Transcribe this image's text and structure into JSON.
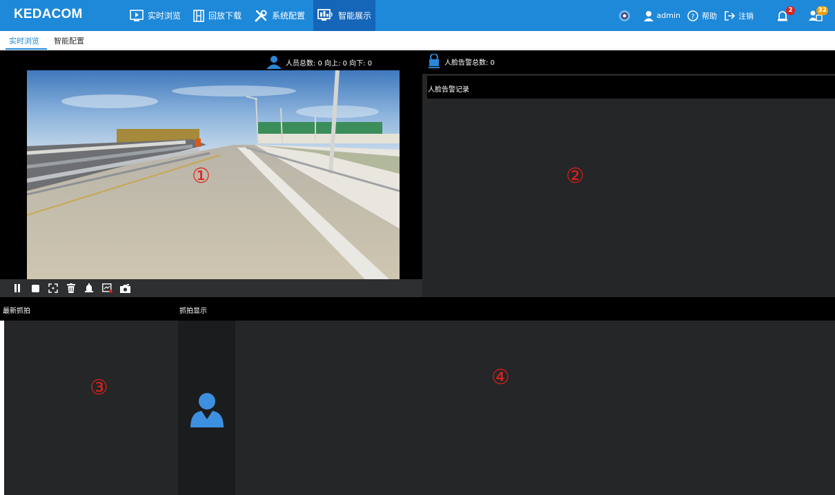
{
  "header": {
    "logo": "KEDACOM",
    "nav": [
      {
        "label": "实时浏览",
        "icon": "live-view-icon"
      },
      {
        "label": "回放下载",
        "icon": "film-icon"
      },
      {
        "label": "系统配置",
        "icon": "tools-icon"
      },
      {
        "label": "智能展示",
        "icon": "smart-display-icon"
      }
    ],
    "active_nav": "智能展示",
    "user": "admin",
    "help": "帮助",
    "logout": "注销",
    "alarm_badge": "2",
    "message_badge": "32"
  },
  "subtabs": {
    "items": [
      "实时浏览",
      "智能配置"
    ],
    "active": "实时浏览"
  },
  "stats": {
    "people": "人员总数: 0 向上: 0 向下: 0",
    "face_alarm": "人脸告警总数: 0"
  },
  "panels": {
    "face_record_title": "人脸告警记录",
    "latest_capture": "最新抓拍",
    "capture_display": "抓拍显示"
  },
  "markers": [
    "①",
    "②",
    "③",
    "④"
  ],
  "toolbar": [
    "pause-icon",
    "stop-icon",
    "fullscreen-icon",
    "delete-icon",
    "alarm-icon",
    "record-icon",
    "snapshot-icon"
  ],
  "colors": {
    "header": "#1e88d9",
    "panel": "#252628",
    "marker": "#e0201b",
    "alarm_badge": "#e0201b",
    "message_badge": "#f2a000"
  }
}
